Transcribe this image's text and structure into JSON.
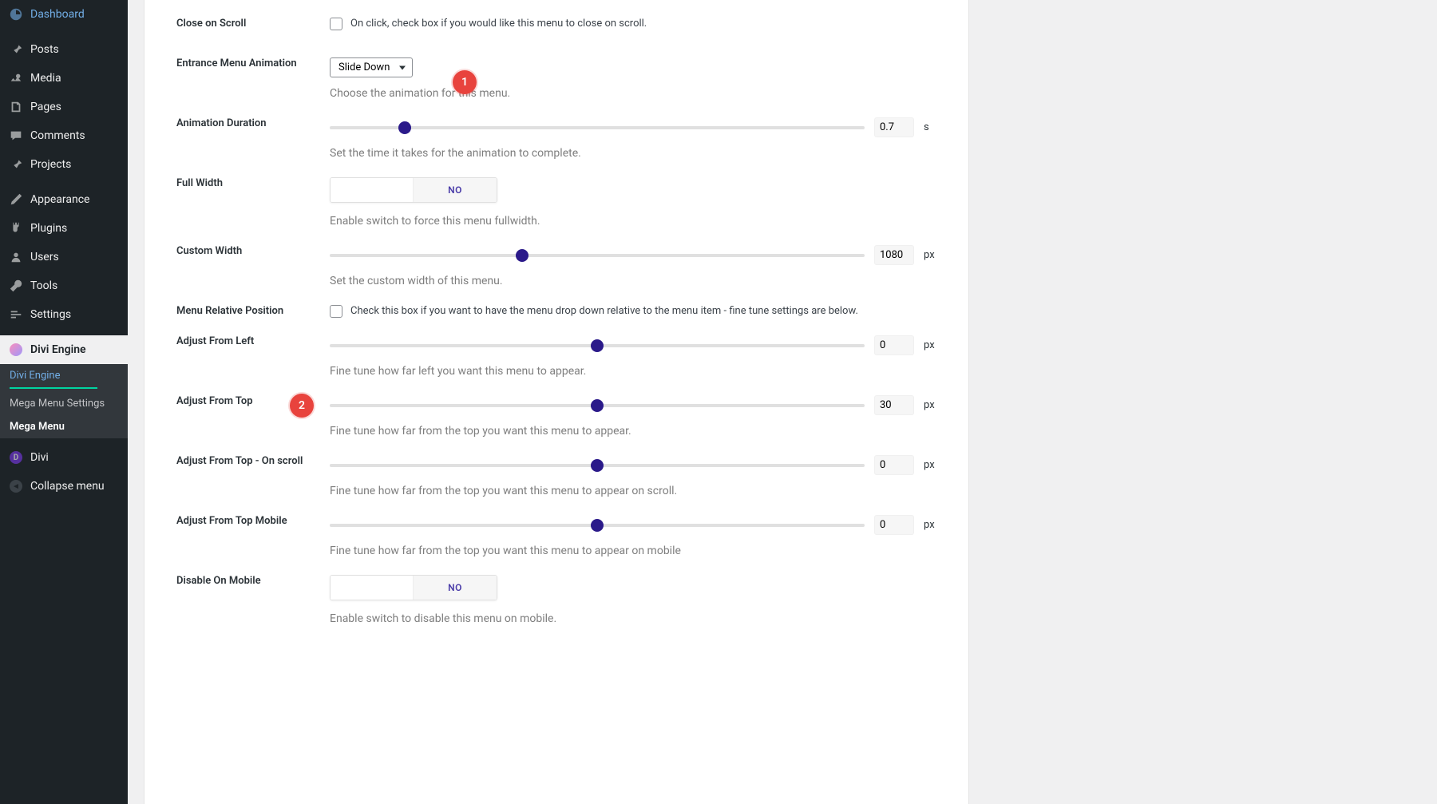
{
  "sidebar": {
    "items": [
      {
        "label": "Dashboard"
      },
      {
        "label": "Posts"
      },
      {
        "label": "Media"
      },
      {
        "label": "Pages"
      },
      {
        "label": "Comments"
      },
      {
        "label": "Projects"
      },
      {
        "label": "Appearance"
      },
      {
        "label": "Plugins"
      },
      {
        "label": "Users"
      },
      {
        "label": "Tools"
      },
      {
        "label": "Settings"
      }
    ],
    "divi_engine": {
      "label": "Divi Engine"
    },
    "submenu": [
      {
        "label": "Divi Engine"
      },
      {
        "label": "Mega Menu Settings"
      },
      {
        "label": "Mega Menu"
      }
    ],
    "divi": {
      "label": "Divi",
      "letter": "D"
    },
    "collapse": {
      "label": "Collapse menu"
    }
  },
  "fields": {
    "close_on_scroll": {
      "label": "Close on Scroll",
      "text": "On click, check box if you would like this menu to close on scroll."
    },
    "entrance_anim": {
      "label": "Entrance Menu Animation",
      "selected": "Slide Down",
      "desc": "Choose the animation for this menu."
    },
    "anim_duration": {
      "label": "Animation Duration",
      "value": "0.7",
      "unit": "s",
      "desc": "Set the time it takes for the animation to complete."
    },
    "full_width": {
      "label": "Full Width",
      "value": "NO",
      "desc": "Enable switch to force this menu fullwidth."
    },
    "custom_width": {
      "label": "Custom Width",
      "value": "1080",
      "unit": "px",
      "desc": "Set the custom width of this menu."
    },
    "rel_pos": {
      "label": "Menu Relative Position",
      "text": "Check this box if you want to have the menu drop down relative to the menu item - fine tune settings are below."
    },
    "adj_left": {
      "label": "Adjust From Left",
      "value": "0",
      "unit": "px",
      "desc": "Fine tune how far left you want this menu to appear."
    },
    "adj_top": {
      "label": "Adjust From Top",
      "value": "30",
      "unit": "px",
      "desc": "Fine tune how far from the top you want this menu to appear."
    },
    "adj_top_scroll": {
      "label": "Adjust From Top - On scroll",
      "value": "0",
      "unit": "px",
      "desc": "Fine tune how far from the top you want this menu to appear on scroll."
    },
    "adj_top_mob": {
      "label": "Adjust From Top Mobile",
      "value": "0",
      "unit": "px",
      "desc": "Fine tune how far from the top you want this menu to appear on mobile"
    },
    "disable_mob": {
      "label": "Disable On Mobile",
      "value": "NO",
      "desc": "Enable switch to disable this menu on mobile."
    }
  },
  "badges": {
    "b1": "1",
    "b2": "2"
  }
}
